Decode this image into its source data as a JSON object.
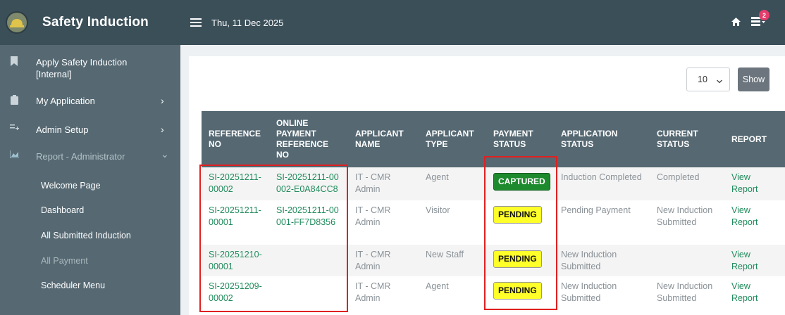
{
  "app": {
    "title": "Safety Induction"
  },
  "header": {
    "date": "Thu, 11 Dec 2025",
    "notification_count": "2"
  },
  "sidebar": {
    "items": [
      {
        "label": "Apply Safety Induction [Internal]",
        "icon": "bookmark-icon"
      },
      {
        "label": "My Application",
        "icon": "clipboard-icon",
        "arrow": "›"
      },
      {
        "label": "Admin Setup",
        "icon": "list-add-icon",
        "arrow": "›"
      },
      {
        "label": "Report - Administrator",
        "icon": "chart-icon",
        "arrow": "⌄"
      }
    ],
    "subitems": [
      {
        "label": "Welcome Page"
      },
      {
        "label": "Dashboard"
      },
      {
        "label": "All Submitted Induction"
      },
      {
        "label": "All Payment"
      },
      {
        "label": "Scheduler Menu"
      }
    ]
  },
  "controls": {
    "per_page": "10",
    "show_label": "Show"
  },
  "table": {
    "headers": [
      "REFERENCE NO",
      "ONLINE PAYMENT REFERENCE NO",
      "APPLICANT NAME",
      "APPLICANT TYPE",
      "PAYMENT STATUS",
      "APPLICATION STATUS",
      "CURRENT STATUS",
      "REPORT"
    ],
    "rows": [
      {
        "ref": "SI-20251211-00002",
        "online_ref": "SI-20251211-00002-E0A84CC8",
        "name": "IT - CMR Admin",
        "type": "Agent",
        "payment": "CAPTURED",
        "app_status": "Induction Completed",
        "current": "Completed",
        "report": "View Report"
      },
      {
        "ref": "SI-20251211-00001",
        "online_ref": "SI-20251211-00001-FF7D8356",
        "name": "IT - CMR Admin",
        "type": "Visitor",
        "payment": "PENDING",
        "app_status": "Pending Payment",
        "current": "New Induction Submitted",
        "report": "View Report"
      },
      {
        "ref": "SI-20251210-00001",
        "online_ref": "",
        "name": "IT - CMR Admin",
        "type": "New Staff",
        "payment": "PENDING",
        "app_status": "New Induction Submitted",
        "current": "",
        "report": "View Report"
      },
      {
        "ref": "SI-20251209-00002",
        "online_ref": "",
        "name": "IT - CMR Admin",
        "type": "Agent",
        "payment": "PENDING",
        "app_status": "New Induction Submitted",
        "current": "New Induction Submitted",
        "report": "View Report"
      }
    ]
  },
  "colors": {
    "header_bg": "#3b4f59",
    "sidebar_bg": "#566973",
    "link": "#1f8b5c",
    "captured": "#1e8a2e",
    "pending": "#ffff2a",
    "highlight": "#e02020"
  }
}
